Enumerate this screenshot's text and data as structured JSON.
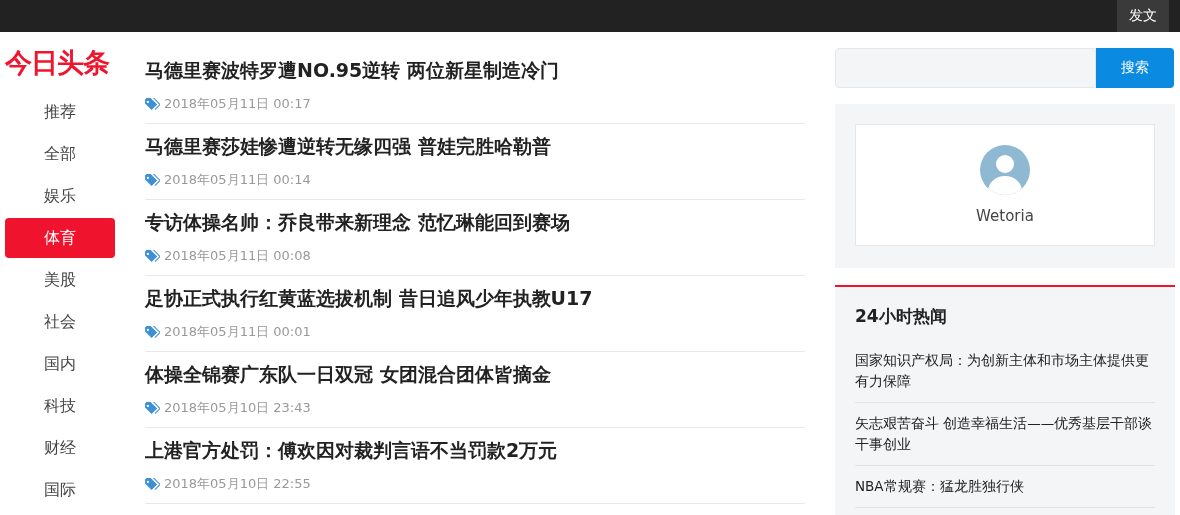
{
  "topbar": {
    "post_button": "发文"
  },
  "logo": "今日头条",
  "nav": [
    {
      "label": "推荐",
      "selected": false
    },
    {
      "label": "全部",
      "selected": false
    },
    {
      "label": "娱乐",
      "selected": false
    },
    {
      "label": "体育",
      "selected": true
    },
    {
      "label": "美股",
      "selected": false
    },
    {
      "label": "社会",
      "selected": false
    },
    {
      "label": "国内",
      "selected": false
    },
    {
      "label": "科技",
      "selected": false
    },
    {
      "label": "财经",
      "selected": false
    },
    {
      "label": "国际",
      "selected": false
    }
  ],
  "articles": [
    {
      "title": "马德里赛波特罗遭NO.95逆转 两位新星制造冷门",
      "time": "2018年05月11日 00:17"
    },
    {
      "title": "马德里赛莎娃惨遭逆转无缘四强 普娃完胜哈勒普",
      "time": "2018年05月11日 00:14"
    },
    {
      "title": "专访体操名帅：乔良带来新理念 范忆琳能回到赛场",
      "time": "2018年05月11日 00:08"
    },
    {
      "title": "足协正式执行红黄蓝选拔机制 昔日追风少年执教U17",
      "time": "2018年05月11日 00:01"
    },
    {
      "title": "体操全锦赛广东队一日双冠 女团混合团体皆摘金",
      "time": "2018年05月10日 23:43"
    },
    {
      "title": "上港官方处罚：傅欢因对裁判言语不当罚款2万元",
      "time": "2018年05月10日 22:55"
    }
  ],
  "search": {
    "button": "搜索"
  },
  "profile": {
    "username": "Wetoria"
  },
  "hot_news": {
    "title": "24小时热闻",
    "items": [
      "国家知识产权局：为创新主体和市场主体提供更有力保障",
      "矢志艰苦奋斗 创造幸福生活——优秀基层干部谈干事创业",
      "NBA常规赛：猛龙胜独行侠"
    ]
  }
}
